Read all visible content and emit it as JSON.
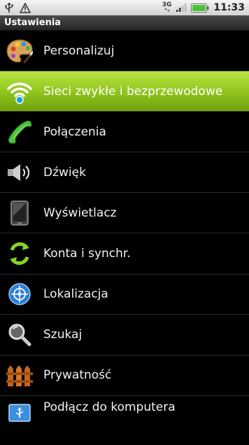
{
  "status_bar": {
    "left_icons": [
      "usb-icon",
      "warning-icon"
    ],
    "network_label": "3G",
    "time": "11:33"
  },
  "title": "Ustawienia",
  "items": [
    {
      "label": "Personalizuj",
      "icon": "palette-icon",
      "selected": false
    },
    {
      "label": "Sieci zwykłe i bezprzewodowe",
      "icon": "wifi-icon",
      "selected": true
    },
    {
      "label": "Połączenia",
      "icon": "phone-handset-icon",
      "selected": false
    },
    {
      "label": "Dźwięk",
      "icon": "speaker-icon",
      "selected": false
    },
    {
      "label": "Wyświetlacz",
      "icon": "display-icon",
      "selected": false
    },
    {
      "label": "Konta i synchr.",
      "icon": "sync-icon",
      "selected": false
    },
    {
      "label": "Lokalizacja",
      "icon": "location-icon",
      "selected": false
    },
    {
      "label": "Szukaj",
      "icon": "search-icon",
      "selected": false
    },
    {
      "label": "Prywatność",
      "icon": "fence-icon",
      "selected": false
    },
    {
      "label": "Podłącz do komputera",
      "icon": "usb-connect-icon",
      "selected": false
    }
  ],
  "colors": {
    "selected_highlight": "#8fc21d",
    "background": "#000000",
    "title_bar": "#333333"
  }
}
